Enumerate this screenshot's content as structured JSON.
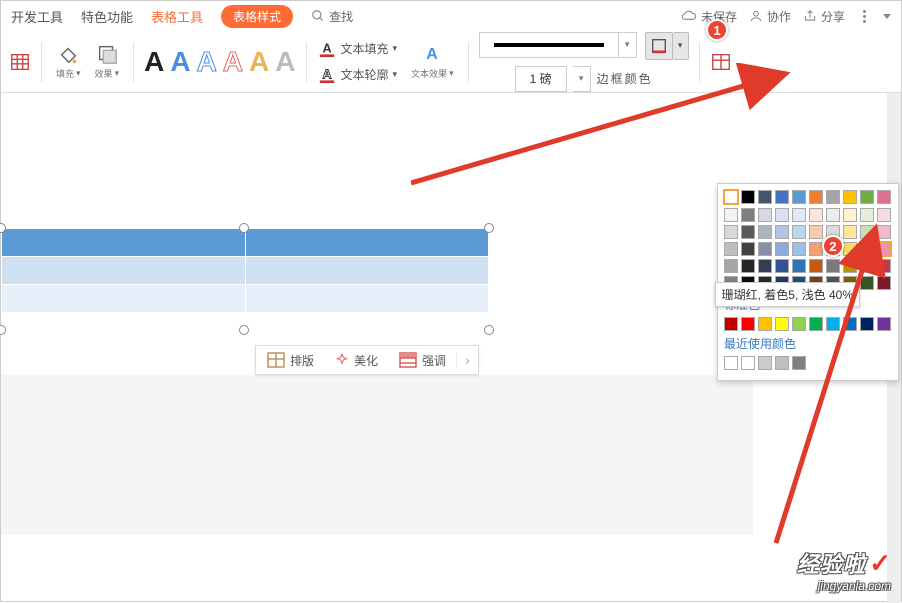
{
  "tabs": {
    "dev": "开发工具",
    "special": "特色功能",
    "tableTool": "表格工具",
    "tableStyle": "表格样式",
    "search": "查找"
  },
  "topRight": {
    "unsaved": "未保存",
    "collab": "协作",
    "share": "分享"
  },
  "toolbar": {
    "fill": "填充",
    "effect": "效果",
    "textFill": "文本填充",
    "textOutline": "文本轮廓",
    "textEffect": "文本效果",
    "weight": "1 磅",
    "borderColor": "边框颜色",
    "styles": [
      "A",
      "A",
      "A",
      "A",
      "A",
      "A"
    ]
  },
  "colorPanel": {
    "tooltip": "珊瑚红, 着色5, 浅色 40%",
    "standard": "标准色",
    "recent": "最近使用颜色",
    "themeRow": [
      "#ffffff",
      "#000000",
      "#44546a",
      "#4472c4",
      "#5b9bd5",
      "#ed7d31",
      "#a5a5a5",
      "#ffc000",
      "#70ad47",
      "#e16f8f"
    ],
    "shades": [
      [
        "#f2f2f2",
        "#7f7f7f",
        "#d6d9e0",
        "#d9e1f2",
        "#deebf7",
        "#fce4d6",
        "#ededed",
        "#fff2cc",
        "#e2efda",
        "#f7dbe3"
      ],
      [
        "#d9d9d9",
        "#595959",
        "#adb3c1",
        "#b4c6e7",
        "#bdd7ee",
        "#f8cbad",
        "#dbdbdb",
        "#ffe699",
        "#c6e0b4",
        "#f0b8c9"
      ],
      [
        "#bfbfbf",
        "#404040",
        "#8490a3",
        "#8ea9db",
        "#9bc2e6",
        "#f4a072",
        "#c9c9c9",
        "#ffd966",
        "#a9d08e",
        "#e995af"
      ],
      [
        "#a6a6a6",
        "#262626",
        "#333f50",
        "#305496",
        "#2e75b6",
        "#c55a11",
        "#7b7b7b",
        "#bf8f00",
        "#548235",
        "#c0394b"
      ],
      [
        "#808080",
        "#0d0d0d",
        "#222a35",
        "#203864",
        "#1f4e79",
        "#833c0c",
        "#525252",
        "#806000",
        "#375623",
        "#7d1829"
      ]
    ],
    "standardColors": [
      "#c00000",
      "#ff0000",
      "#ffc000",
      "#ffff00",
      "#92d050",
      "#00b050",
      "#00b0f0",
      "#0070c0",
      "#002060",
      "#7030a0"
    ],
    "recentColors": [
      "#ffffff",
      "#ffffff",
      "#cccccc",
      "#bfbfbf",
      "#808080"
    ]
  },
  "floatBar": {
    "layout": "排版",
    "beautify": "美化",
    "highlight": "强调"
  },
  "annot": {
    "one": "1",
    "two": "2"
  },
  "watermark": {
    "brand": "经验啦",
    "sub": "jingyanla.com"
  }
}
